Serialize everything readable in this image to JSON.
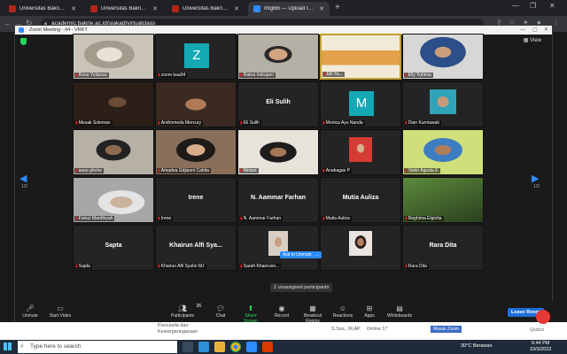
{
  "browser": {
    "tabs": [
      {
        "title": "Universitas Bakrie - SIM Akadem",
        "icon_color": "#b3261e",
        "active": false
      },
      {
        "title": "Universitas Bakrie - SIM Akadem",
        "icon_color": "#b3261e",
        "active": false
      },
      {
        "title": "Universitas Bakrie - SIM Akadem",
        "icon_color": "#b3261e",
        "active": false
      },
      {
        "title": "ImgBB — Upload Image — Free",
        "icon_color": "#2d8cff",
        "active": true
      }
    ],
    "url": "academic.bakrie.ac.id/siakad/virtualclass"
  },
  "zoom": {
    "title": "Zoom Meeting - 44 - VRKT",
    "view_label": "View",
    "page_indicator": "1/2",
    "ask_to_unmute": "Ask to Unmute",
    "more": "...",
    "unassigned": "2 unassigned participants",
    "participants_count": "26",
    "participants": [
      {
        "name": "Rosa Yulianza",
        "display": "",
        "initial": "",
        "bg": "#c9c3b8",
        "type": "video"
      },
      {
        "name": "zoom baa04",
        "display": "",
        "initial": "Z",
        "bg": "#13a8b4",
        "type": "initial"
      },
      {
        "name": "Ratna Indrajani",
        "display": "",
        "initial": "",
        "bg": "#b5b0a6",
        "type": "video"
      },
      {
        "name": "Elli Ya...",
        "display": "",
        "initial": "",
        "bg": "#f2ead9",
        "type": "video"
      },
      {
        "name": "Elly Yuhirsa",
        "display": "",
        "initial": "",
        "bg": "#d7d8d6",
        "type": "video"
      },
      {
        "name": "Mesak Soleman",
        "display": "",
        "initial": "",
        "bg": "#2b1f18",
        "type": "video"
      },
      {
        "name": "Andromeda Mercury",
        "display": "",
        "initial": "",
        "bg": "#3a2a22",
        "type": "video"
      },
      {
        "name": "Eli Sulih",
        "display": "Eli Sulih",
        "initial": "",
        "bg": "",
        "type": "name"
      },
      {
        "name": "Monica Ayu Nanda",
        "display": "",
        "initial": "M",
        "bg": "#13a8b4",
        "type": "initial"
      },
      {
        "name": "Dian Kurniawati",
        "display": "",
        "initial": "",
        "bg": "#d9d4cc",
        "type": "video"
      },
      {
        "name": "asep ghofur",
        "display": "",
        "initial": "",
        "bg": "#b7b0a4",
        "type": "video"
      },
      {
        "name": "Amadea Gdjianni Cahita",
        "display": "",
        "initial": "",
        "bg": "#8a6f5a",
        "type": "video"
      },
      {
        "name": "Melani",
        "display": "",
        "initial": "",
        "bg": "#e7e2da",
        "type": "video"
      },
      {
        "name": "Anabagas P",
        "display": "",
        "initial": "",
        "bg": "#d43b32",
        "type": "video"
      },
      {
        "name": "Valdo Agusta E",
        "display": "",
        "initial": "",
        "bg": "#cfe07a",
        "type": "video"
      },
      {
        "name": "Fairuz Mardhiyah",
        "display": "",
        "initial": "",
        "bg": "#a7a7a7",
        "type": "video"
      },
      {
        "name": "Irene",
        "display": "Irene",
        "initial": "",
        "bg": "",
        "type": "name"
      },
      {
        "name": "N. Aammar Farhan",
        "display": "N. Aammar Farhan",
        "initial": "",
        "bg": "",
        "type": "name"
      },
      {
        "name": "Mutia Auliza",
        "display": "Mutia Auliza",
        "initial": "",
        "bg": "",
        "type": "name"
      },
      {
        "name": "Reghima Elgiotia",
        "display": "",
        "initial": "",
        "bg": "#3d5a2a",
        "type": "video"
      },
      {
        "name": "Sapta",
        "display": "Sapta",
        "initial": "",
        "bg": "",
        "type": "name"
      },
      {
        "name": "Khairun Alfi Syahri MJ",
        "display": "Khairun Alfi Sya...",
        "initial": "",
        "bg": "",
        "type": "name"
      },
      {
        "name": "Sarah Khaerunn...",
        "display": "",
        "initial": "",
        "bg": "#d8cfc2",
        "type": "video"
      },
      {
        "name": "",
        "display": "",
        "initial": "",
        "bg": "#e9e4df",
        "type": "video"
      },
      {
        "name": "Rara Dita",
        "display": "Rara Dita",
        "initial": "",
        "bg": "",
        "type": "name"
      }
    ],
    "toolbar": [
      {
        "label": "Unmute",
        "icon": "mic-muted-icon"
      },
      {
        "label": "Start Video",
        "icon": "video-off-icon"
      },
      {
        "label": "Participants",
        "icon": "participants-icon"
      },
      {
        "label": "Chat",
        "icon": "chat-icon"
      },
      {
        "label": "Share Screen",
        "icon": "share-screen-icon"
      },
      {
        "label": "Record",
        "icon": "record-icon"
      },
      {
        "label": "Breakout Rooms",
        "icon": "breakout-rooms-icon"
      },
      {
        "label": "Reactions",
        "icon": "reactions-icon"
      },
      {
        "label": "Apps",
        "icon": "apps-icon"
      },
      {
        "label": "Whiteboards",
        "icon": "whiteboards-icon"
      }
    ],
    "leave": "Leave Room"
  },
  "webpage": {
    "course": "Pancasila dan Kewarganegaraan",
    "lecturer": "S.Sos., M.AP.",
    "online": "Online 17",
    "join": "Masuk Zoom",
    "quiz": "Quizizz"
  },
  "taskbar": {
    "search_placeholder": "Type here to search",
    "weather": "30°C  Berawan",
    "time": "6:44 PM",
    "date": "10/3/2022"
  }
}
